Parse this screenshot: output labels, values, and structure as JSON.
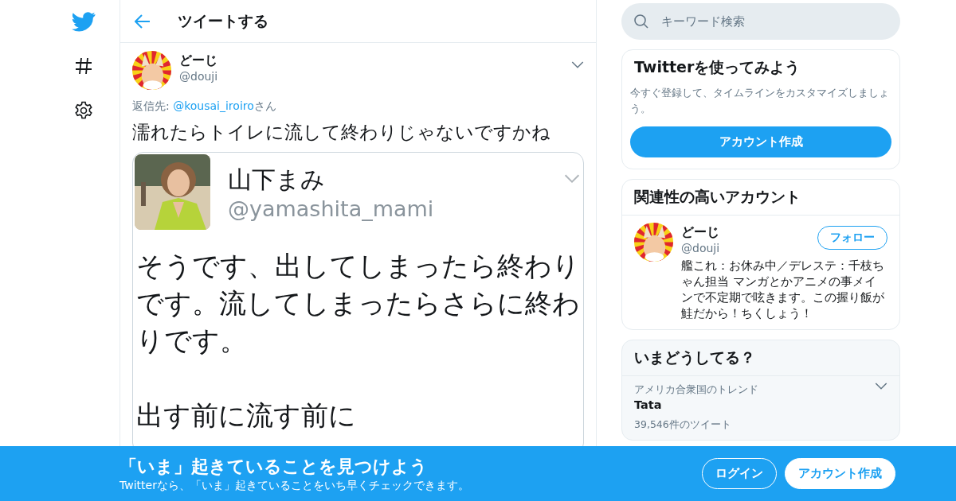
{
  "header": {
    "title": "ツイートする"
  },
  "tweet": {
    "author": {
      "name": "どーじ",
      "handle": "@douji"
    },
    "reply_to": {
      "prefix": "返信先: ",
      "handle": "@kousai_iroiro",
      "suffix": "さん"
    },
    "text": "濡れたらトイレに流して終わりじゃないですかね",
    "image": {
      "name": "山下まみ",
      "handle": "@yamashita_mami",
      "paragraphs": [
        "そうです、出してしまったら終わりです。流してしまったらさらに終わりです。",
        "出す前に流す前に"
      ]
    }
  },
  "search": {
    "placeholder": "キーワード検索"
  },
  "signup_card": {
    "title": "Twitterを使ってみよう",
    "description": "今すぐ登録して、タイムラインをカスタマイズしましょう。",
    "button": "アカウント作成"
  },
  "related_card": {
    "title": "関連性の高いアカウント",
    "accounts": [
      {
        "name": "どーじ",
        "handle": "@douji",
        "bio": "艦これ：お休み中／デレステ：千枝ちゃん担当 マンガとかアニメの事メインで不定期で呟きます。この握り飯が鮭だから！ちくしょう！",
        "button": "フォロー"
      }
    ]
  },
  "trends_card": {
    "title": "いまどうしてる？",
    "trends": [
      {
        "context": "アメリカ合衆国のトレンド",
        "name": "Tata",
        "count": "39,546件のツイート"
      }
    ]
  },
  "banner": {
    "title": "「いま」起きていることを見つけよう",
    "subtitle": "Twitterなら、「いま」起きていることをいち早くチェックできます。",
    "buttons": [
      {
        "label": "ログイン",
        "kind": "outline"
      },
      {
        "label": "アカウント作成",
        "kind": "solid"
      }
    ]
  }
}
